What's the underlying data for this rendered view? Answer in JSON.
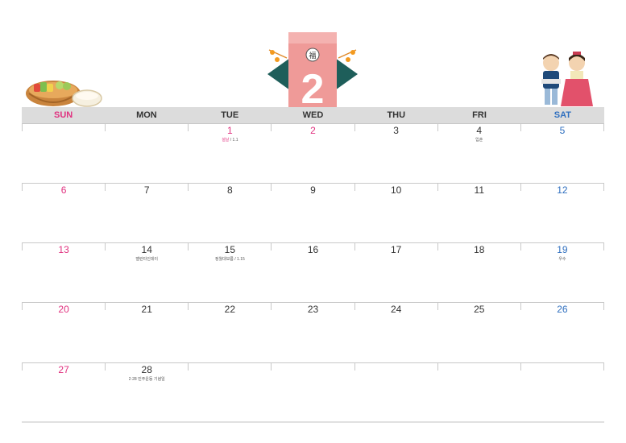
{
  "header": {
    "month_number": "2",
    "charm_glyph": "福"
  },
  "weekdays": [
    "SUN",
    "MON",
    "TUE",
    "WED",
    "THU",
    "FRI",
    "SAT"
  ],
  "colors": {
    "sunday": "#e0317f",
    "saturday": "#2f6fbf",
    "text": "#333333",
    "header_bg": "#dcdcdc"
  },
  "weeks": [
    [
      {
        "day": ""
      },
      {
        "day": ""
      },
      {
        "day": "1",
        "color": "red",
        "note_red": "설날",
        "note": " / 1.1"
      },
      {
        "day": "2",
        "color": "red"
      },
      {
        "day": "3"
      },
      {
        "day": "4",
        "note": "입춘"
      },
      {
        "day": "5",
        "color": "blue"
      }
    ],
    [
      {
        "day": "6",
        "color": "red"
      },
      {
        "day": "7"
      },
      {
        "day": "8"
      },
      {
        "day": "9"
      },
      {
        "day": "10"
      },
      {
        "day": "11"
      },
      {
        "day": "12",
        "color": "blue"
      }
    ],
    [
      {
        "day": "13",
        "color": "red"
      },
      {
        "day": "14",
        "note": "밸런타인데이"
      },
      {
        "day": "15",
        "note": "정월대보름 / 1.15"
      },
      {
        "day": "16"
      },
      {
        "day": "17"
      },
      {
        "day": "18"
      },
      {
        "day": "19",
        "color": "blue",
        "note": "우수"
      }
    ],
    [
      {
        "day": "20",
        "color": "red"
      },
      {
        "day": "21"
      },
      {
        "day": "22"
      },
      {
        "day": "23"
      },
      {
        "day": "24"
      },
      {
        "day": "25"
      },
      {
        "day": "26",
        "color": "blue"
      }
    ],
    [
      {
        "day": "27",
        "color": "red"
      },
      {
        "day": "28",
        "note": "2·28 민주운동 기념일"
      },
      {
        "day": ""
      },
      {
        "day": ""
      },
      {
        "day": ""
      },
      {
        "day": ""
      },
      {
        "day": ""
      }
    ]
  ]
}
